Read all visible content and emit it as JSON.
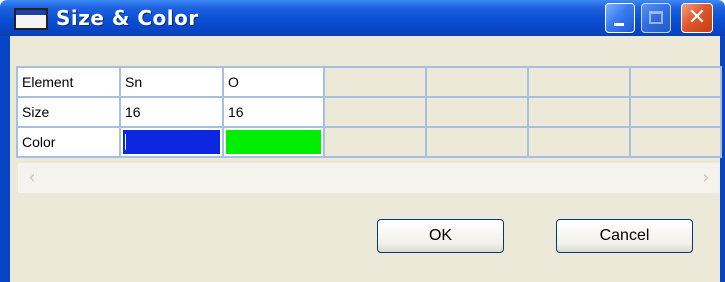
{
  "window": {
    "title": "Size & Color",
    "title_icon": "window-app-icon",
    "controls": [
      "minimize-icon",
      "maximize-icon",
      "close-icon"
    ],
    "close_glyph": "✕"
  },
  "table": {
    "rows": [
      {
        "label": "Element",
        "values": [
          "Sn",
          "O"
        ]
      },
      {
        "label": "Size",
        "values": [
          "16",
          "16"
        ]
      },
      {
        "label": "Color",
        "colors": [
          "#0b27e0",
          "#00ee00"
        ]
      }
    ],
    "empty_columns": 4
  },
  "scrollbar": {
    "left_arrow": "‹",
    "right_arrow": "›"
  },
  "buttons": {
    "ok": "OK",
    "cancel": "Cancel"
  },
  "colors": {
    "titlebar": "#0a4fd4",
    "client_bg": "#ece9d8",
    "grid_line": "#a7bfe0"
  }
}
